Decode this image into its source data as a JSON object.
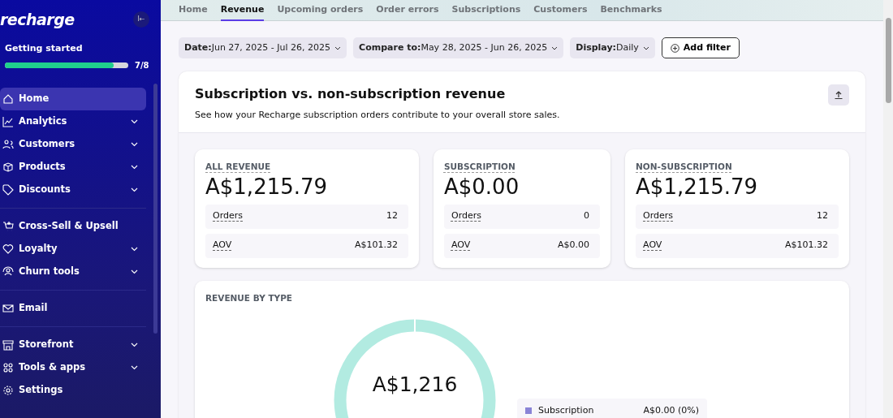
{
  "sidebar": {
    "logo": "recharge",
    "collapse_icon": "I←",
    "progress": {
      "label": "Getting started",
      "level": 0.88,
      "count": "7/8"
    },
    "groups": [
      [
        {
          "label": "Home",
          "expandable": false,
          "selected": true
        },
        {
          "label": "Analytics",
          "expandable": true,
          "selected": false
        },
        {
          "label": "Customers",
          "expandable": true,
          "selected": false
        },
        {
          "label": "Products",
          "expandable": true,
          "selected": false
        },
        {
          "label": "Discounts",
          "expandable": true,
          "selected": false
        }
      ],
      [
        {
          "label": "Cross-Sell & Upsell",
          "expandable": false,
          "selected": false
        },
        {
          "label": "Loyalty",
          "expandable": true,
          "selected": false
        },
        {
          "label": "Churn tools",
          "expandable": true,
          "selected": false
        }
      ],
      [
        {
          "label": "Email",
          "expandable": false,
          "selected": false
        }
      ],
      [
        {
          "label": "Storefront",
          "expandable": true,
          "selected": false
        },
        {
          "label": "Tools & apps",
          "expandable": true,
          "selected": false
        },
        {
          "label": "Settings",
          "expandable": false,
          "selected": false
        }
      ]
    ]
  },
  "tabs": [
    {
      "label": "Home",
      "selected": false
    },
    {
      "label": "Revenue",
      "selected": true
    },
    {
      "label": "Upcoming orders",
      "selected": false
    },
    {
      "label": "Order errors",
      "selected": false
    },
    {
      "label": "Subscriptions",
      "selected": false
    },
    {
      "label": "Customers",
      "selected": false
    },
    {
      "label": "Benchmarks",
      "selected": false
    }
  ],
  "filters": [
    {
      "label": "Date:",
      "value": "Jun 27, 2025 - Jul 26, 2025"
    },
    {
      "label": "Compare to:",
      "value": "May 28, 2025 - Jun 26, 2025"
    },
    {
      "label": "Display:",
      "value": "Daily"
    }
  ],
  "add_filter": "Add filter",
  "panel": {
    "title": "Subscription vs. non-subscription revenue",
    "subtitle": "See how your Recharge subscription orders contribute to your overall store sales.",
    "metrics": [
      {
        "heading": "ALL REVENUE",
        "value": "A$1,215.79",
        "rows": [
          {
            "label": "Orders",
            "value": "12"
          },
          {
            "label": "AOV",
            "value": "A$101.32"
          }
        ]
      },
      {
        "heading": "SUBSCRIPTION",
        "value": "A$0.00",
        "rows": [
          {
            "label": "Orders",
            "value": "0"
          },
          {
            "label": "AOV",
            "value": "A$0.00"
          }
        ]
      },
      {
        "heading": "NON-SUBSCRIPTION",
        "value": "A$1,215.79",
        "rows": [
          {
            "label": "Orders",
            "value": "12"
          },
          {
            "label": "AOV",
            "value": "A$101.32"
          }
        ]
      }
    ],
    "revenue_by_type": {
      "heading": "REVENUE BY TYPE",
      "center_value": "A$1,216",
      "legend": [
        {
          "label": "Subscription",
          "value": "A$0.00 (0%)",
          "color": "#8a84d6"
        }
      ]
    }
  }
}
